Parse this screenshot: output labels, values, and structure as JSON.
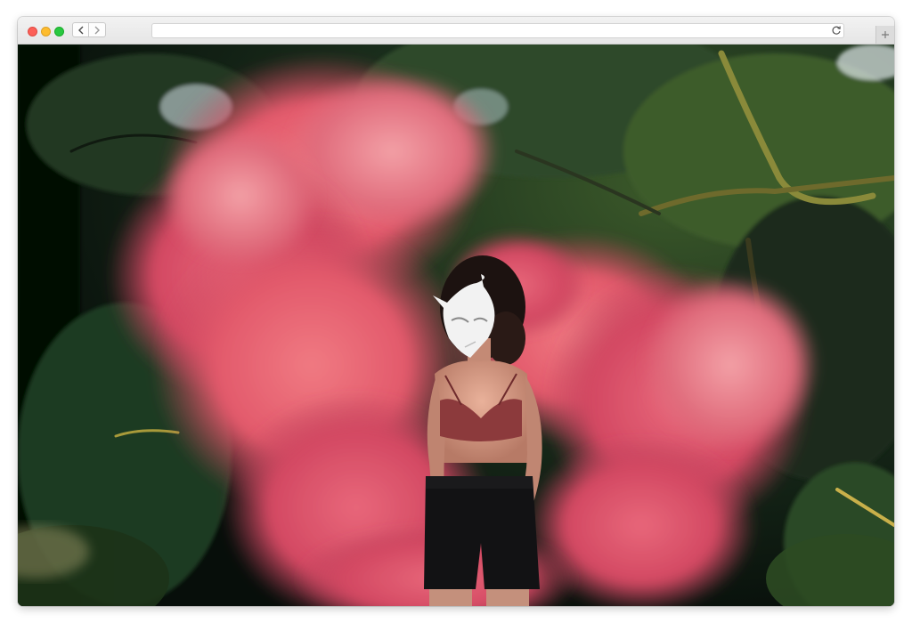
{
  "browser": {
    "url_value": "",
    "url_placeholder": "",
    "icons": {
      "close": "close-window-icon",
      "minimize": "minimize-window-icon",
      "zoom": "zoom-window-icon",
      "back": "chevron-left-icon",
      "forward": "chevron-right-icon",
      "reload": "reload-icon",
      "new_tab": "plus-icon"
    },
    "colors": {
      "close": "#fc5f57",
      "minimize": "#fdbc2e",
      "zoom": "#28c840"
    }
  },
  "photo": {
    "subject": "woman-in-white-cat-mask",
    "colors": {
      "smoke": "#e0576a",
      "foliage": "#1f3b22",
      "mask": "#f2f2f2"
    }
  }
}
